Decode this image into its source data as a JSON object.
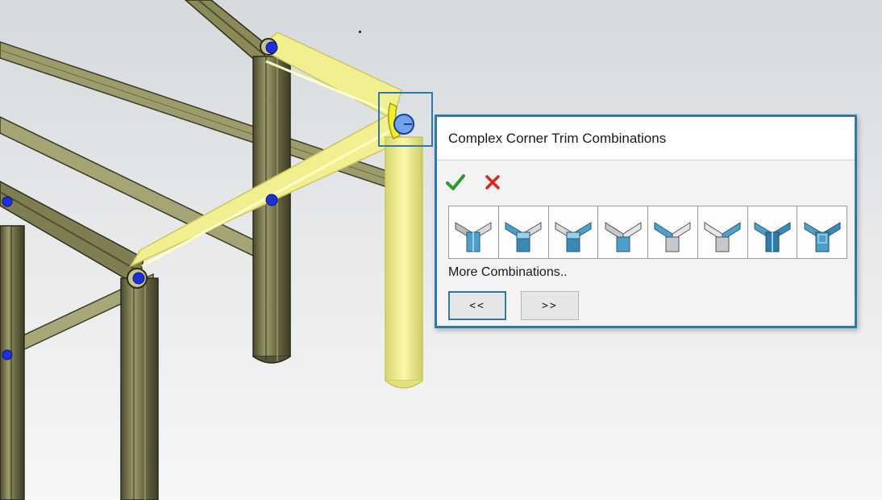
{
  "popup": {
    "title": "Complex Corner Trim Combinations",
    "ok_icon": "green-checkmark-icon",
    "cancel_icon": "red-x-icon",
    "combinations_count": 8,
    "more_label": "More Combinations..",
    "prev_label": "<<",
    "next_label": ">>"
  },
  "colors": {
    "selection_yellow": "#f1ef8f",
    "frame_member": "#8b8a5c",
    "point_blue": "#1d2fd6",
    "accent_border": "#2f79a8",
    "ok_green": "#2e9a2e",
    "cancel_red": "#d9261c"
  }
}
